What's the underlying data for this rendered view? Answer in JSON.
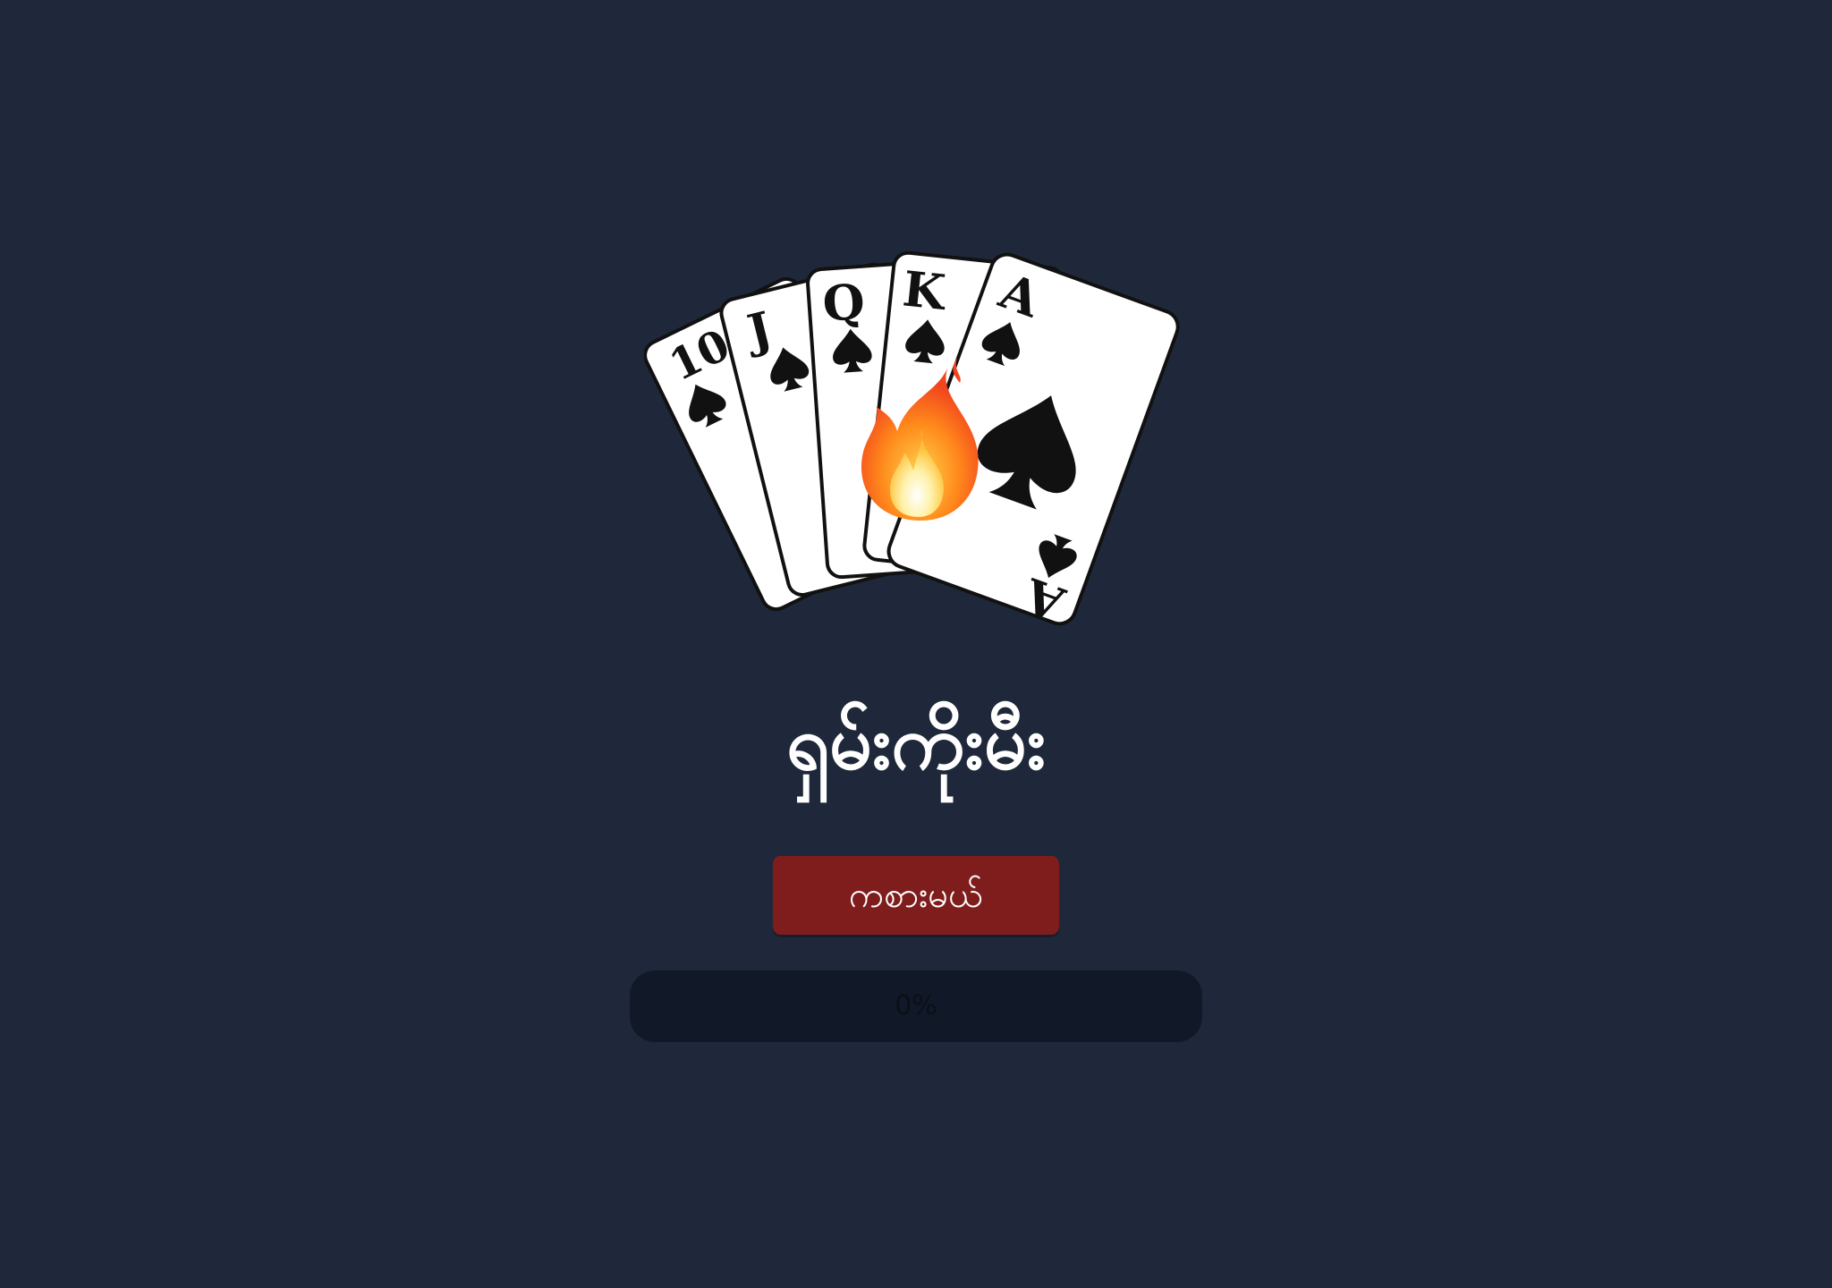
{
  "logo": {
    "cards": [
      {
        "rank": "10"
      },
      {
        "rank": "J"
      },
      {
        "rank": "Q"
      },
      {
        "rank": "K"
      },
      {
        "rank": "A"
      }
    ],
    "icon": "royal-flush-fire-icon"
  },
  "title": "ရှမ်းကိုးမီး",
  "play_button": {
    "label": "ကစားမယ်"
  },
  "progress": {
    "value": 0,
    "label": "0%"
  },
  "colors": {
    "background": "#1f283a",
    "button": "#7f1d1d",
    "progress_track": "#111827"
  }
}
